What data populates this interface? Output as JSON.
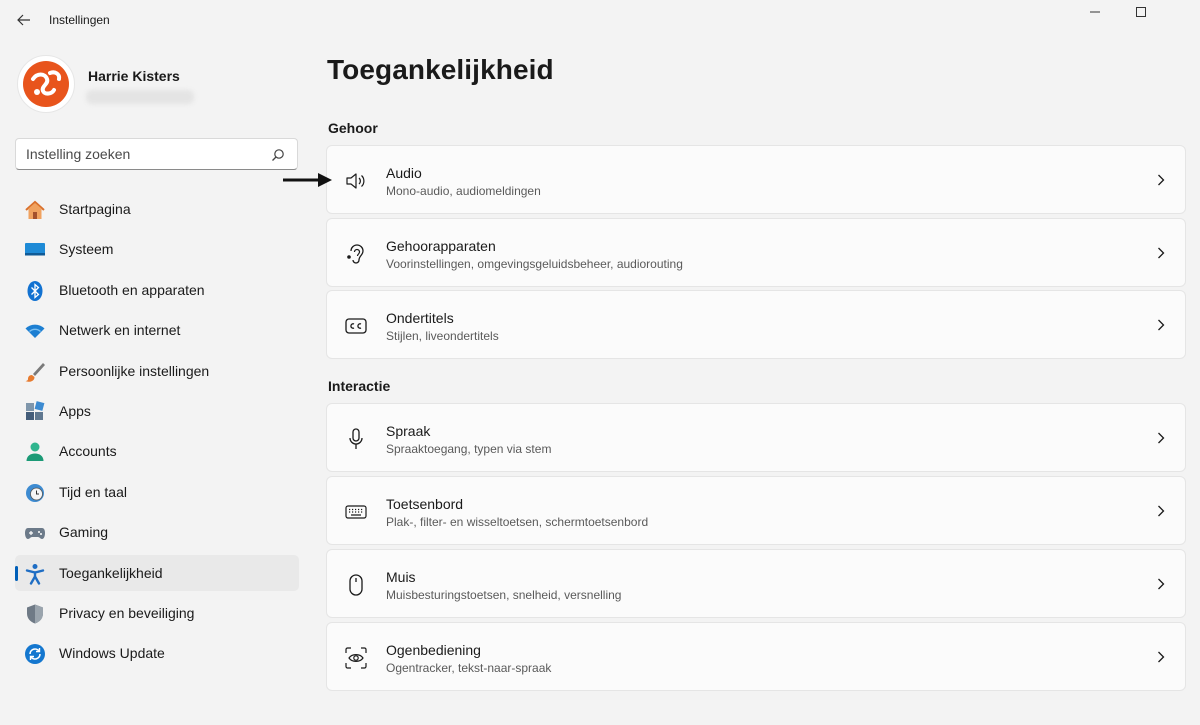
{
  "window": {
    "title": "Instellingen"
  },
  "user": {
    "name": "Harrie Kisters"
  },
  "search": {
    "placeholder": "Instelling zoeken"
  },
  "sidebar": {
    "items": [
      {
        "label": "Startpagina",
        "icon": "home-icon"
      },
      {
        "label": "Systeem",
        "icon": "monitor-icon"
      },
      {
        "label": "Bluetooth en apparaten",
        "icon": "bluetooth-icon"
      },
      {
        "label": "Netwerk en internet",
        "icon": "wifi-icon"
      },
      {
        "label": "Persoonlijke instellingen",
        "icon": "brush-icon"
      },
      {
        "label": "Apps",
        "icon": "apps-icon"
      },
      {
        "label": "Accounts",
        "icon": "person-icon"
      },
      {
        "label": "Tijd en taal",
        "icon": "clock-globe-icon"
      },
      {
        "label": "Gaming",
        "icon": "gamepad-icon"
      },
      {
        "label": "Toegankelijkheid",
        "icon": "accessibility-icon",
        "active": true
      },
      {
        "label": "Privacy en beveiliging",
        "icon": "shield-icon"
      },
      {
        "label": "Windows Update",
        "icon": "update-icon"
      }
    ]
  },
  "main": {
    "title": "Toegankelijkheid",
    "sections": [
      {
        "title": "Gehoor",
        "cards": [
          {
            "title": "Audio",
            "subtitle": "Mono-audio, audiomeldingen",
            "icon": "speaker-icon"
          },
          {
            "title": "Gehoorapparaten",
            "subtitle": "Voorinstellingen, omgevingsgeluidsbeheer, audiorouting",
            "icon": "ear-icon"
          },
          {
            "title": "Ondertitels",
            "subtitle": "Stijlen, liveondertitels",
            "icon": "closed-captions-icon"
          }
        ]
      },
      {
        "title": "Interactie",
        "cards": [
          {
            "title": "Spraak",
            "subtitle": "Spraaktoegang, typen via stem",
            "icon": "microphone-icon"
          },
          {
            "title": "Toetsenbord",
            "subtitle": "Plak-, filter- en wisseltoetsen, schermtoetsenbord",
            "icon": "keyboard-icon"
          },
          {
            "title": "Muis",
            "subtitle": "Muisbesturingstoetsen, snelheid, versnelling",
            "icon": "mouse-icon"
          },
          {
            "title": "Ogenbediening",
            "subtitle": "Ogentracker, tekst-naar-spraak",
            "icon": "eye-control-icon"
          }
        ]
      }
    ]
  },
  "colors": {
    "accent": "#005fb8",
    "background": "#f3f3f3",
    "card": "#fbfbfb"
  }
}
